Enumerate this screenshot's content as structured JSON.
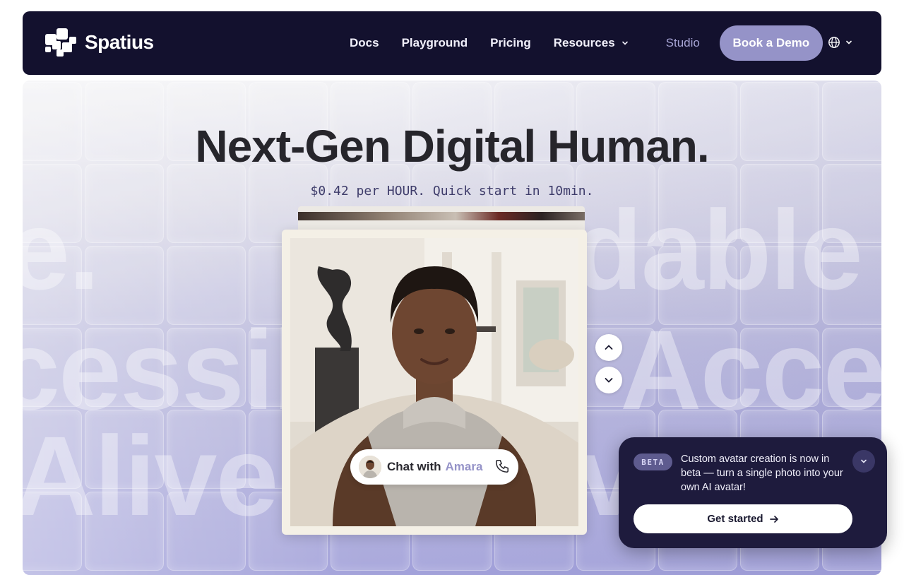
{
  "brand": {
    "name": "Spatius"
  },
  "nav": {
    "links": [
      "Docs",
      "Playground",
      "Pricing",
      "Resources"
    ],
    "studio": "Studio",
    "cta": "Book a Demo",
    "language_icon": "globe-icon"
  },
  "hero": {
    "title": "Next-Gen Digital Human.",
    "subtitle": "$0.42 per HOUR. Quick start in 10min.",
    "background_words": [
      "e.",
      "dable",
      "cessib",
      "Acce",
      "Alive.",
      "v"
    ]
  },
  "chat": {
    "label": "Chat with",
    "name": "Amara"
  },
  "toast": {
    "badge": "BETA",
    "message": "Custom avatar creation is now in beta — turn a single photo into your own AI avatar!",
    "button": "Get started"
  },
  "colors": {
    "nav_bg": "#13112e",
    "accent": "#9593c8",
    "toast_bg": "#1e1b3d"
  }
}
